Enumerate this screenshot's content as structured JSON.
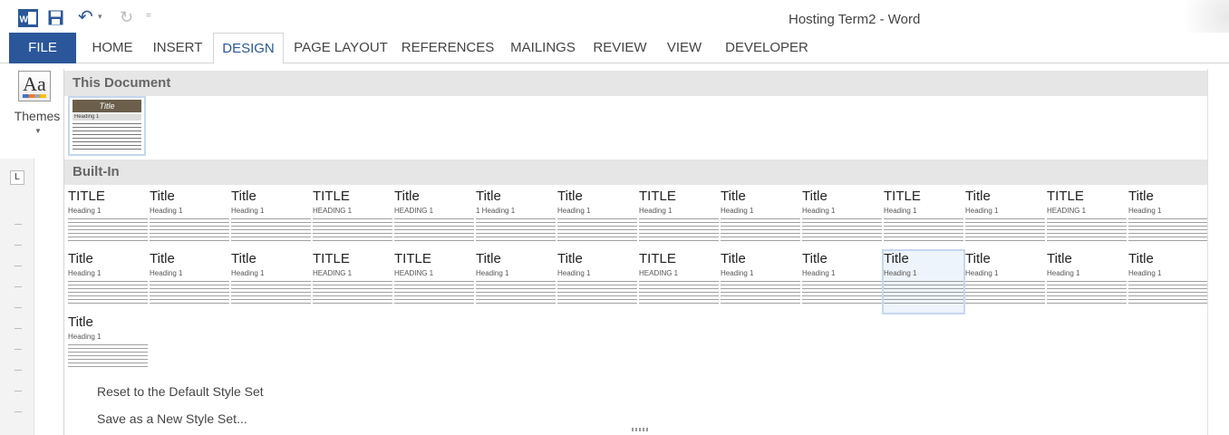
{
  "window": {
    "title": "Hosting Term2 - Word"
  },
  "qat": {
    "undo": "↶",
    "redo": "↻",
    "more": "="
  },
  "tabs": [
    {
      "label": "FILE"
    },
    {
      "label": "HOME"
    },
    {
      "label": "INSERT"
    },
    {
      "label": "DESIGN"
    },
    {
      "label": "PAGE LAYOUT"
    },
    {
      "label": "REFERENCES"
    },
    {
      "label": "MAILINGS"
    },
    {
      "label": "REVIEW"
    },
    {
      "label": "VIEW"
    },
    {
      "label": "DEVELOPER"
    }
  ],
  "themes": {
    "icon_text": "Aa",
    "label": "Themes"
  },
  "ruler": {
    "tab_stop": "L"
  },
  "gallery": {
    "this_document_header": "This Document",
    "this_document_thumb": {
      "title": "Title",
      "heading": "Heading 1"
    },
    "built_in_header": "Built-In",
    "row1": [
      {
        "title": "TITLE",
        "heading": "Heading 1"
      },
      {
        "title": "Title",
        "heading": "Heading 1"
      },
      {
        "title": "Title",
        "heading": "Heading 1"
      },
      {
        "title": "TITLE",
        "heading": "HEADING 1"
      },
      {
        "title": "Title",
        "heading": "HEADING 1"
      },
      {
        "title": "Title",
        "heading": "1 Heading 1"
      },
      {
        "title": "Title",
        "heading": "Heading 1"
      },
      {
        "title": "TITLE",
        "heading": "Heading 1"
      },
      {
        "title": "Title",
        "heading": "Heading 1"
      },
      {
        "title": "Title",
        "heading": "Heading 1"
      },
      {
        "title": "TITLE",
        "heading": "Heading 1"
      },
      {
        "title": "Title",
        "heading": "Heading 1"
      },
      {
        "title": "TITLE",
        "heading": "HEADING 1"
      },
      {
        "title": "Title",
        "heading": "Heading 1"
      }
    ],
    "row2": [
      {
        "title": "Title",
        "heading": "Heading 1"
      },
      {
        "title": "Title",
        "heading": "Heading 1"
      },
      {
        "title": "Title",
        "heading": "Heading 1"
      },
      {
        "title": "TITLE",
        "heading": "HEADING 1"
      },
      {
        "title": "TITLE",
        "heading": "HEADING 1"
      },
      {
        "title": "Title",
        "heading": "Heading 1"
      },
      {
        "title": "Title",
        "heading": "Heading 1"
      },
      {
        "title": "TITLE",
        "heading": "HEADING 1"
      },
      {
        "title": "Title",
        "heading": "Heading 1"
      },
      {
        "title": "Title",
        "heading": "Heading 1"
      },
      {
        "title": "Title",
        "heading": "Heading 1"
      },
      {
        "title": "Title",
        "heading": "Heading 1"
      },
      {
        "title": "Title",
        "heading": "Heading 1"
      },
      {
        "title": "Title",
        "heading": "Heading 1"
      }
    ],
    "row3": [
      {
        "title": "Title",
        "heading": "Heading 1"
      }
    ]
  },
  "menu": {
    "reset": "Reset to the Default Style Set",
    "save_new": "Save as a New Style Set..."
  },
  "colors": {
    "accent": "#2b579a",
    "header_bg": "#e6e6e6"
  }
}
